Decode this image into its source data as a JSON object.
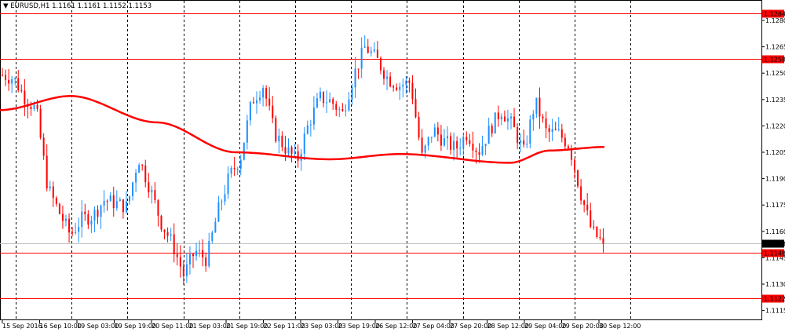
{
  "header": {
    "symbol": "EURUSD,H1",
    "ohlc": "1.1161 1.1161 1.1152 1.1153"
  },
  "chart_data": {
    "type": "candlestick",
    "title": "EURUSD,H1",
    "ylim": [
      1.1108,
      1.1291
    ],
    "y_ticks": [
      "1.1280",
      "1.1265",
      "1.1250",
      "1.1235",
      "1.1220",
      "1.1205",
      "1.1190",
      "1.1175",
      "1.1160",
      "1.1145",
      "1.1130",
      "1.1115"
    ],
    "x_ticks": [
      "15 Sep 2016",
      "16 Sep 10:00",
      "19 Sep 03:00",
      "19 Sep 19:00",
      "20 Sep 11:00",
      "21 Sep 03:00",
      "21 Sep 19:00",
      "22 Sep 11:00",
      "23 Sep 03:00",
      "23 Sep 19:00",
      "26 Sep 12:00",
      "27 Sep 04:00",
      "27 Sep 20:00",
      "28 Sep 12:00",
      "29 Sep 04:00",
      "29 Sep 20:00",
      "30 Sep 12:00"
    ],
    "price_path": [
      1.1249,
      1.1247,
      1.1236,
      1.1229,
      1.1185,
      1.1171,
      1.1158,
      1.1167,
      1.1169,
      1.1178,
      1.1176,
      1.1174,
      1.1202,
      1.1185,
      1.1165,
      1.1153,
      1.1135,
      1.1149,
      1.1144,
      1.1171,
      1.1191,
      1.1202,
      1.1234,
      1.1243,
      1.1216,
      1.1207,
      1.12,
      1.1221,
      1.1236,
      1.1234,
      1.1227,
      1.1249,
      1.1265,
      1.1258,
      1.1247,
      1.1243,
      1.1245,
      1.1202,
      1.1218,
      1.1211,
      1.1207,
      1.1216,
      1.1205,
      1.1218,
      1.1229,
      1.122,
      1.1205,
      1.1234,
      1.1216,
      1.1216,
      1.1209,
      1.1182,
      1.116,
      1.1153
    ],
    "moving_average": [
      1.1229,
      1.1237,
      1.1222,
      1.1205,
      1.1201,
      1.1204,
      1.1199,
      1.1206,
      1.1208
    ],
    "horizontal_levels": [
      {
        "label": "1.1284",
        "value": 1.1284,
        "color": "#ff0000"
      },
      {
        "label": "1.1258",
        "value": 1.1258,
        "color": "#ff0000"
      },
      {
        "label": "1.1148",
        "value": 1.1148,
        "color": "#ff0000"
      },
      {
        "label": "1.1122",
        "value": 1.1122,
        "color": "#ff0000"
      }
    ],
    "current_price": {
      "label": "1.1153",
      "value": 1.1153
    },
    "colors": {
      "bull": "#1e90ff",
      "bear": "#ff0000",
      "ma": "#ff0000",
      "grid": "#000000"
    }
  }
}
